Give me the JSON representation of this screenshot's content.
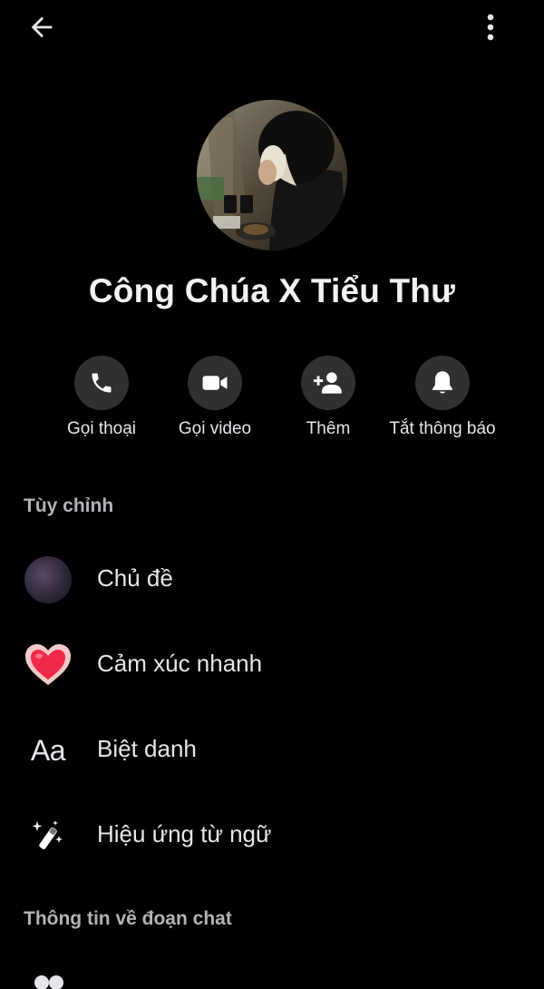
{
  "header": {
    "back_icon": "arrow-left-icon",
    "more_icon": "more-vertical-icon"
  },
  "profile": {
    "name": "Công Chúa X Tiểu Thư"
  },
  "actions": [
    {
      "label": "Gọi thoại",
      "icon": "phone-icon"
    },
    {
      "label": "Gọi video",
      "icon": "video-camera-icon"
    },
    {
      "label": "Thêm",
      "icon": "add-person-icon"
    },
    {
      "label": "Tắt thông báo",
      "icon": "bell-icon"
    }
  ],
  "customize": {
    "title": "Tùy chỉnh",
    "items": [
      {
        "label": "Chủ đề",
        "icon": "theme-swatch-icon"
      },
      {
        "label": "Cảm xúc nhanh",
        "icon": "heart-icon"
      },
      {
        "label": "Biệt danh",
        "icon": "aa-text-icon",
        "icon_text": "Aa"
      },
      {
        "label": "Hiệu ứng từ ngữ",
        "icon": "magic-wand-icon"
      }
    ]
  },
  "chat_info": {
    "title": "Thông tin về đoạn chat",
    "next_icon": "people-icon"
  },
  "colors": {
    "background": "#000000",
    "circle_button": "#303030",
    "text_primary": "#e4e6eb",
    "text_secondary": "#b0b3b8",
    "heart": "#f02849"
  }
}
